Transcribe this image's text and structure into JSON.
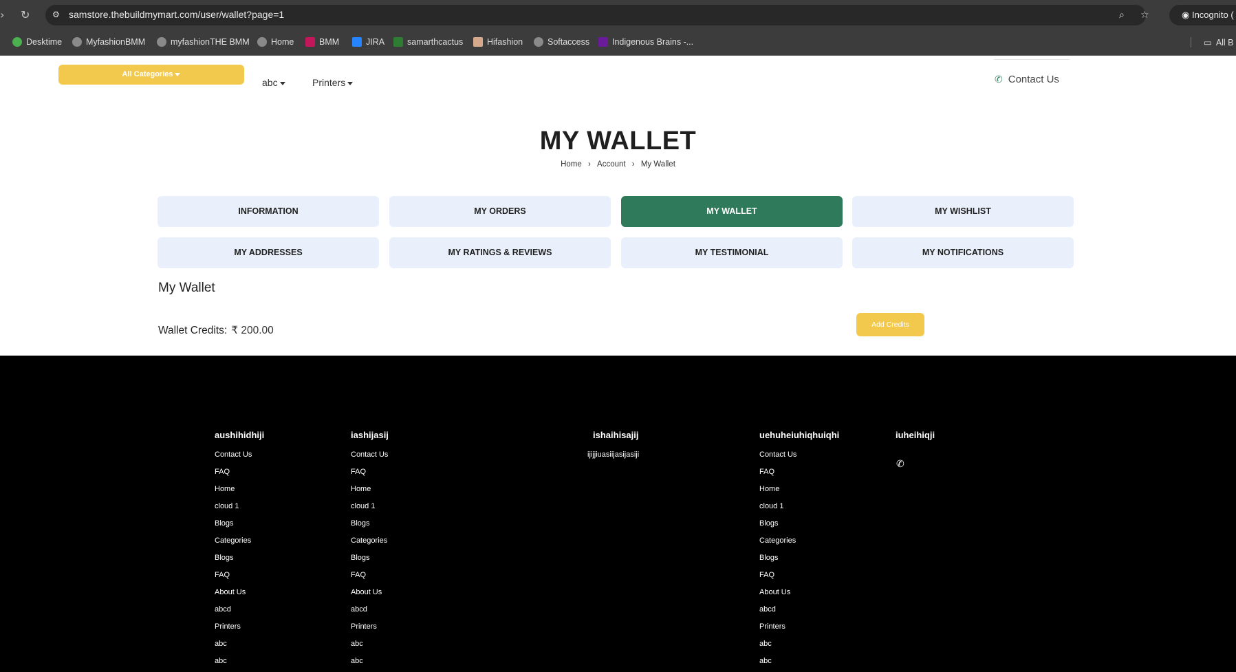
{
  "browser": {
    "url": "samstore.thebuildmymart.com/user/wallet?page=1",
    "incognito_label": "Incognito (",
    "all_bookmarks_label": "All B",
    "bookmarks": [
      {
        "label": "Desktime"
      },
      {
        "label": "MyfashionBMM"
      },
      {
        "label": "myfashionTHE BMM"
      },
      {
        "label": "Home"
      },
      {
        "label": "BMM"
      },
      {
        "label": "JIRA"
      },
      {
        "label": "samarthcactus"
      },
      {
        "label": "Hifashion"
      },
      {
        "label": "Softaccess"
      },
      {
        "label": "Indigenous Brains -..."
      }
    ]
  },
  "header": {
    "categories_button": "All Categories",
    "menu": [
      {
        "label": "abc"
      },
      {
        "label": "Printers"
      }
    ],
    "contact_label": "Contact Us"
  },
  "page": {
    "title": "MY WALLET",
    "breadcrumb": [
      "Home",
      "Account",
      "My Wallet"
    ],
    "breadcrumb_sep": "›"
  },
  "tabs": [
    {
      "label": "INFORMATION",
      "active": false
    },
    {
      "label": "MY ORDERS",
      "active": false
    },
    {
      "label": "MY WALLET",
      "active": true
    },
    {
      "label": "MY WISHLIST",
      "active": false
    },
    {
      "label": "MY ADDRESSES",
      "active": false
    },
    {
      "label": "MY RATINGS & REVIEWS",
      "active": false
    },
    {
      "label": "MY TESTIMONIAL",
      "active": false
    },
    {
      "label": "MY NOTIFICATIONS",
      "active": false
    }
  ],
  "wallet": {
    "heading": "My Wallet",
    "credits_label": "Wallet Credits:",
    "credits_value": "₹ 200.00",
    "add_credits_button": "Add Credits"
  },
  "footer": {
    "col1": {
      "title": "aushihidhiji",
      "links": [
        "Contact Us",
        "FAQ",
        "Home",
        "cloud 1",
        "Blogs",
        "Categories",
        "Blogs",
        "FAQ",
        "About Us",
        "abcd",
        "Printers",
        "abc",
        "abc"
      ]
    },
    "col2": {
      "title": "iashijasij",
      "links": [
        "Contact Us",
        "FAQ",
        "Home",
        "cloud 1",
        "Blogs",
        "Categories",
        "Blogs",
        "FAQ",
        "About Us",
        "abcd",
        "Printers",
        "abc",
        "abc"
      ]
    },
    "col3": {
      "title": "ishaihisajij",
      "text": "ijijjiuasiijasijasiji"
    },
    "col4": {
      "title": "uehuheiuhiqhuiqhi",
      "links": [
        "Contact Us",
        "FAQ",
        "Home",
        "cloud 1",
        "Blogs",
        "Categories",
        "Blogs",
        "FAQ",
        "About Us",
        "abcd",
        "Printers",
        "abc",
        "abc"
      ]
    },
    "col5": {
      "title": "iuheihiqji"
    }
  },
  "colors": {
    "accent_yellow": "#f2c94c",
    "active_tab_green": "#2f7a5a",
    "tab_bg": "#e9f0fb",
    "footer_bg": "#000000"
  },
  "icons": [
    "back-icon",
    "reload-icon",
    "site-info-icon",
    "zoom-icon",
    "star-icon",
    "incognito-icon",
    "folder-icon",
    "phone-icon"
  ]
}
